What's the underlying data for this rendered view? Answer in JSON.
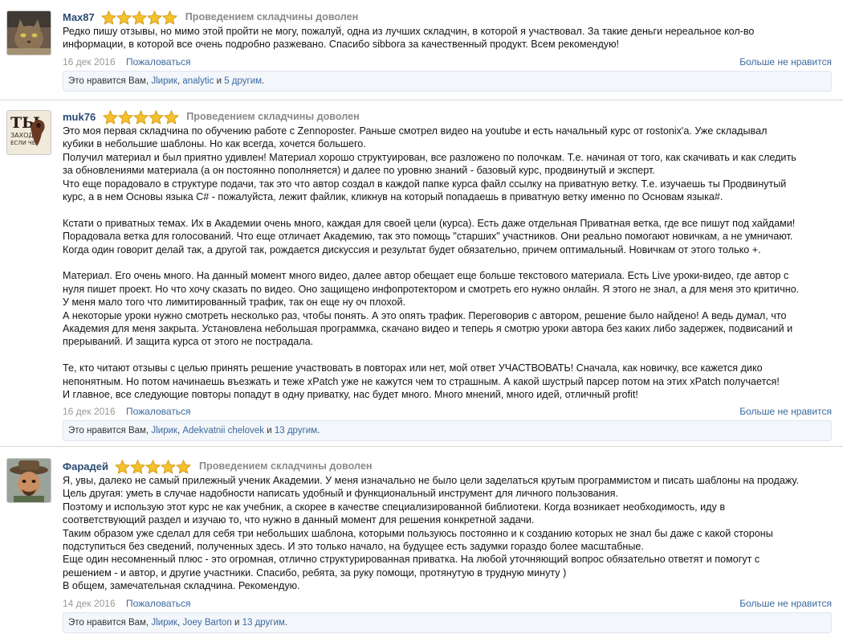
{
  "colors": {
    "username": "#2b4a73",
    "link": "#3b6aa0",
    "star_fill": "#f4c12f",
    "star_stroke": "#d39a12",
    "likes_bg": "#f3f6fa"
  },
  "reviews": [
    {
      "user": "Max87",
      "rating": 5,
      "verdict": "Проведением складчины доволен",
      "avatar_icon": "cat-avatar-icon",
      "paragraphs": [
        "Редко пишу отзывы, но мимо этой пройти не могу, пожалуй, одна из лучших складчин, в которой я участвовал. За такие деньги нереальное кол-во",
        "информации, в которой все очень подробно разжевано. Спасибо sibbora за качественный продукт. Всем рекомендую!"
      ],
      "date": "16 дек 2016",
      "report_label": "Пожаловаться",
      "unlike_label": "Больше не нравится",
      "likes": {
        "prefix": "Это нравится Вам,",
        "user1": "Jlирик",
        "sep": ",",
        "user2": "analytic",
        "and": "и",
        "others": "5 другим",
        "end": "."
      }
    },
    {
      "user": "muk76",
      "rating": 5,
      "verdict": "Проведением складчины доволен",
      "avatar_icon": "poster-avatar-icon",
      "avatar_text": [
        "ТЫ",
        "ЗАХОДИ",
        "ЕСЛИ ЧЕ"
      ],
      "paragraphs": [
        "Это моя первая складчина по обучению работе с Zennoposter. Раньше смотрел видео на youtube и есть начальный курс от rostonix'a. Уже складывал",
        "кубики в небольшие шаблоны. Но как всегда, хочется большего.",
        "Получил материал и был приятно удивлен! Материал хорошо структуирован, все разложено по полочкам. Т.е. начиная от того, как скачивать и как следить",
        "за обновлениями материала (а он постоянно пополняется) и далее по уровню знаний - базовый курс, продвинутый и эксперт.",
        "Что еще порадовало в структуре подачи, так это что автор создал в каждой папке курса файл ссылку на приватную ветку. Т.е. изучаешь ты Продвинутый",
        "курс, а в нем Основы языка C# - пожалуйста, лежит файлик, кликнув на который попадаешь в приватную ветку именно по Основам языка#.",
        "",
        "Кстати о приватных темах. Их в Академии очень много, каждая для своей цели (курса). Есть даже отдельная Приватная ветка, где все пишут под хайдами!",
        "Порадовала ветка для голосований. Что еще отличает Академию, так это помощь \"старших\" участников. Они реально помогают новичкам, а не умничают.",
        "Когда один говорит делай так, а другой так, рождается дискуссия и результат будет обязательно, причем оптимальный. Новичкам от этого только +.",
        "",
        "Материал. Его очень много. На данный момент много видео, далее автор обещает еще больше текстового материала. Есть Live уроки-видео, где автор с",
        "нуля пишет проект. Но что хочу сказать по видео. Оно защищено инфопротектором и смотреть его нужно онлайн. Я этого не знал, а для меня это критично.",
        "У меня мало того что лимитированный трафик, так он еще ну оч плохой.",
        "А некоторые уроки нужно смотреть несколько раз, чтобы понять. А это опять трафик. Переговорив с автором, решение было найдено! А ведь думал, что",
        "Академия для меня закрыта. Установлена небольшая программка, скачано видео и теперь я смотрю уроки автора без каких либо задержек, подвисаний и",
        "прерываний. И защита курса от этого не пострадала.",
        "",
        "Те, кто читают отзывы с целью принять решение участвовать в повторах или нет, мой ответ УЧАСТВОВАТЬ! Сначала, как новичку, все кажется дико",
        "непонятным. Но потом начинаешь въезжать и теже xPatch уже не кажутся чем то страшным. А какой шустрый парсер потом на этих xPatch получается!",
        "И главное, все следующие повторы попадут в одну приватку, нас будет много. Много мнений, много идей, отличный profit!"
      ],
      "date": "16 дек 2016",
      "report_label": "Пожаловаться",
      "unlike_label": "Больше не нравится",
      "likes": {
        "prefix": "Это нравится Вам,",
        "user1": "Jlирик",
        "sep": ",",
        "user2": "Adekvatnii chelovek",
        "and": "и",
        "others": "13 другим",
        "end": "."
      }
    },
    {
      "user": "Фарадей",
      "rating": 5,
      "verdict": "Проведением складчины доволен",
      "avatar_icon": "man-with-hat-avatar-icon",
      "paragraphs": [
        "Я, увы, далеко не самый прилежный ученик Академии. У меня изначально не было цели заделаться крутым программистом и писать шаблоны на продажу.",
        "Цель другая: уметь в случае надобности написать удобный и функциональный инструмент для личного пользования.",
        "Поэтому и использую этот курс не как учебник, а скорее в качестве специализированной библиотеки. Когда возникает необходимость, иду в",
        "соответствующий раздел и изучаю то, что нужно в данный момент для решения конкретной задачи.",
        "Таким образом уже сделал для себя три небольших шаблона, которыми пользуюсь постоянно и к созданию которых не знал бы даже с какой стороны",
        "подступиться без сведений, полученных здесь. И это только начало, на будущее есть задумки гораздо более масштабные.",
        "Еще один несомненный плюс - это огромная, отлично структурированная приватка. На любой уточняющий вопрос обязательно ответят и помогут с",
        "решением - и автор, и другие участники. Спасибо, ребята, за руку помощи, протянутую в трудную минуту )",
        "В общем, замечательная складчина. Рекомендую."
      ],
      "date": "14 дек 2016",
      "report_label": "Пожаловаться",
      "unlike_label": "Больше не нравится",
      "likes": {
        "prefix": "Это нравится Вам,",
        "user1": "Jlирик",
        "sep": ",",
        "user2": "Joey Barton",
        "and": "и",
        "others": "13 другим",
        "end": "."
      }
    }
  ]
}
